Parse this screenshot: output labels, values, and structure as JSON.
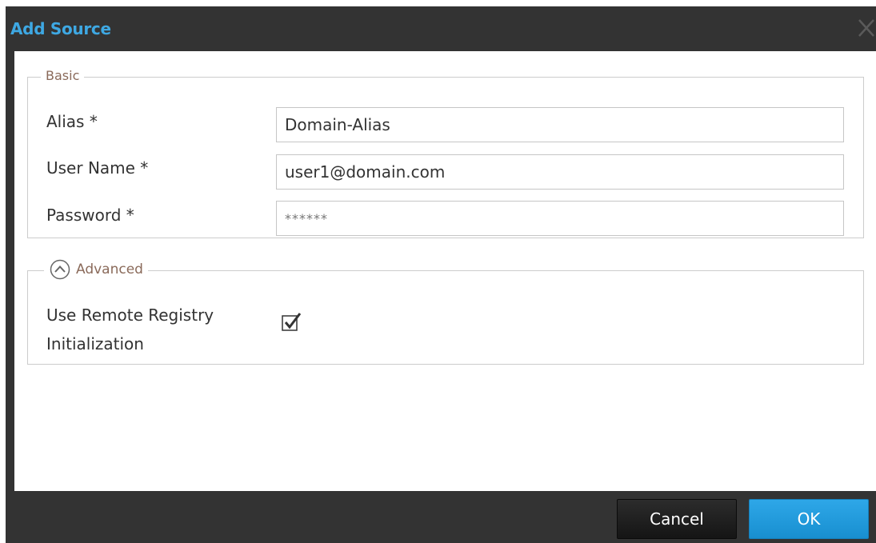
{
  "dialog": {
    "title": "Add Source"
  },
  "basic": {
    "legend": "Basic",
    "alias_label": "Alias *",
    "alias_value": "Domain-Alias",
    "username_label": "User Name *",
    "username_value": "user1@domain.com",
    "password_label": "Password *",
    "password_placeholder": "******"
  },
  "advanced": {
    "legend": "Advanced",
    "expanded": true,
    "remote_registry_label_line1": "Use Remote Registry",
    "remote_registry_label_line2": "Initialization",
    "remote_registry_checked": true
  },
  "footer": {
    "cancel_label": "Cancel",
    "ok_label": "OK"
  },
  "colors": {
    "title": "#3ea8e3",
    "chrome": "#333333",
    "ok_button": "#1f9ddf",
    "legend_text": "#8a6a5a"
  },
  "icons": {
    "close": "close-icon",
    "advanced_toggle": "chevron-up-circle-icon",
    "checkbox": "checkmark-icon"
  }
}
